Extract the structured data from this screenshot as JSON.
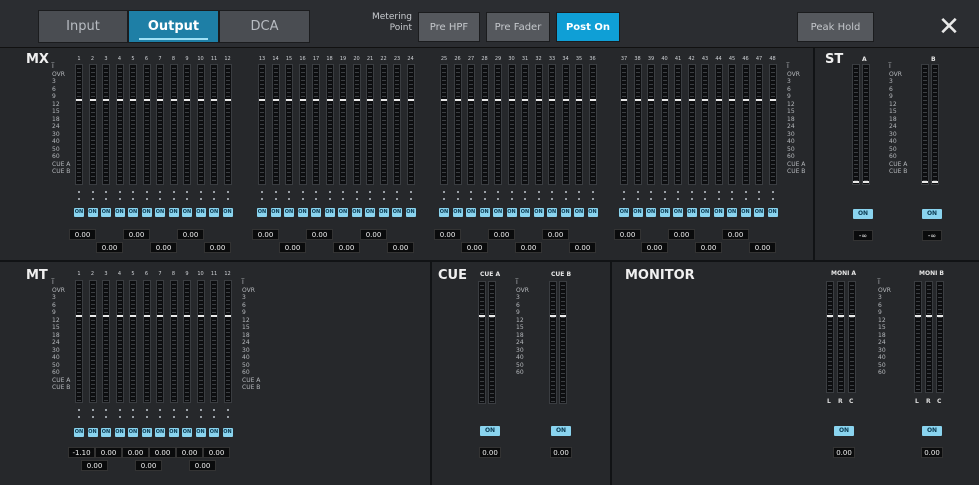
{
  "tabs": [
    {
      "label": "Input",
      "active": false
    },
    {
      "label": "Output",
      "active": true
    },
    {
      "label": "DCA",
      "active": false
    }
  ],
  "metering": {
    "label_line1": "Metering",
    "label_line2": "Point",
    "buttons": [
      {
        "label": "Pre HPF",
        "active": false
      },
      {
        "label": "Pre Fader",
        "active": false
      },
      {
        "label": "Post On",
        "active": true
      }
    ]
  },
  "peak_hold": "Peak Hold",
  "close": "✕",
  "scale": [
    "I̅",
    "OVR",
    "3",
    "6",
    "9",
    "12",
    "15",
    "18",
    "24",
    "30",
    "40",
    "50",
    "60",
    "CUE A",
    "CUE B"
  ],
  "mx": {
    "title": "MX",
    "channels": [
      "1",
      "2",
      "3",
      "4",
      "5",
      "6",
      "7",
      "8",
      "9",
      "10",
      "11",
      "12",
      "13",
      "14",
      "15",
      "16",
      "17",
      "18",
      "19",
      "20",
      "21",
      "22",
      "23",
      "24",
      "25",
      "26",
      "27",
      "28",
      "29",
      "30",
      "31",
      "32",
      "33",
      "34",
      "35",
      "36",
      "37",
      "38",
      "39",
      "40",
      "41",
      "42",
      "43",
      "44",
      "45",
      "46",
      "47",
      "48"
    ],
    "on_label": "ON",
    "values_top": [
      "0.00",
      "0.00",
      "0.00",
      "0.00",
      "0.00",
      "0.00"
    ],
    "values_bottom": [
      "0.00",
      "0.00",
      "0.00",
      "0.00",
      "0.00",
      "0.00"
    ]
  },
  "st": {
    "title": "ST",
    "a": "A",
    "b": "B",
    "on_label": "ON",
    "value_a": "-∞",
    "value_b": "-∞"
  },
  "mt": {
    "title": "MT",
    "channels": [
      "1",
      "2",
      "3",
      "4",
      "5",
      "6",
      "7",
      "8",
      "9",
      "10",
      "11",
      "12"
    ],
    "on_label": "ON",
    "values_top": [
      "-1.10",
      "0.00",
      "0.00",
      "0.00",
      "0.00",
      "0.00"
    ],
    "values_bottom": [
      "0.00",
      "0.00",
      "0.00",
      "0.00",
      "0.00",
      "0.00"
    ]
  },
  "cue": {
    "title": "CUE",
    "a": "CUE A",
    "b": "CUE B",
    "on_label": "ON",
    "value_a": "0.00",
    "value_b": "0.00"
  },
  "monitor": {
    "title": "MONITOR",
    "a": "MONI A",
    "b": "MONI B",
    "lrc": [
      "L",
      "R",
      "C"
    ],
    "on_label": "ON",
    "value_a": "0.00",
    "value_b": "0.00"
  }
}
